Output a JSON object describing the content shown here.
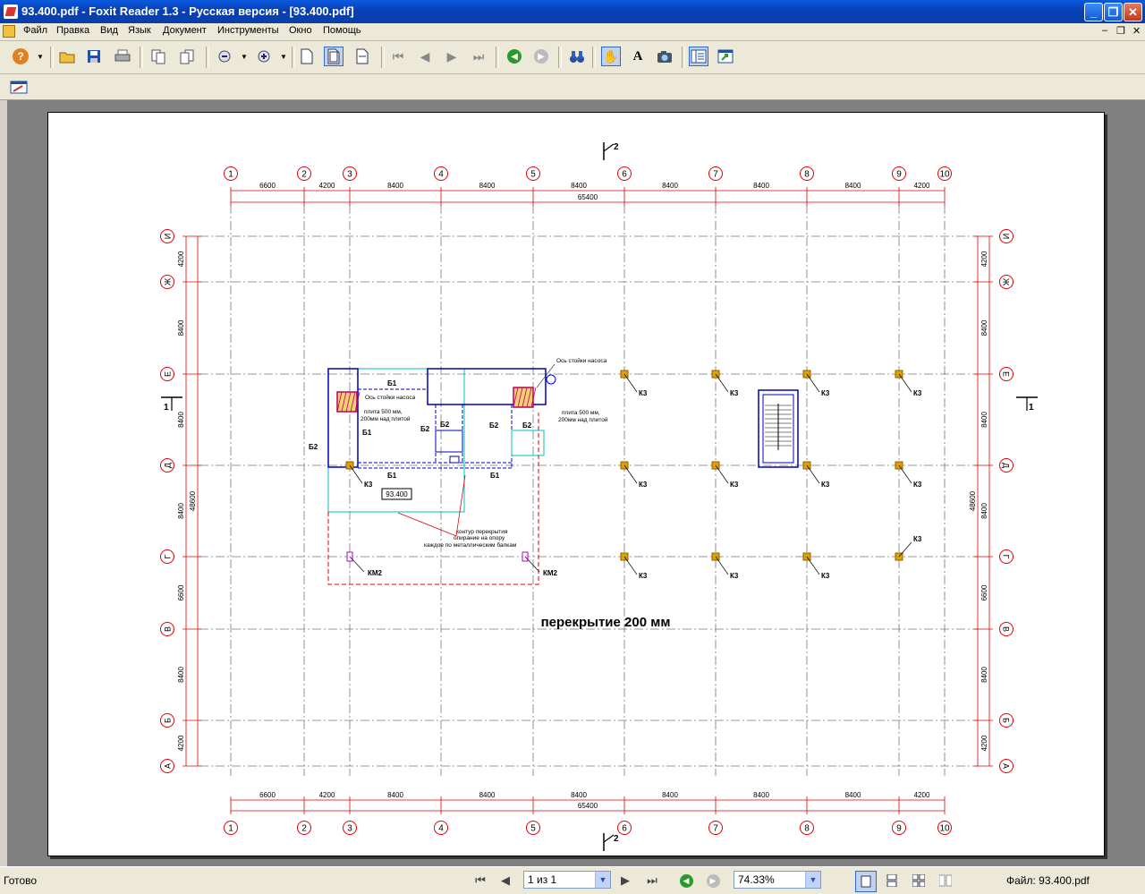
{
  "window": {
    "title": "93.400.pdf - Foxit Reader 1.3 - Русская версия  - [93.400.pdf]"
  },
  "menu": {
    "items": [
      "Файл",
      "Правка",
      "Вид",
      "Язык",
      "Документ",
      "Инструменты",
      "Окно",
      "Помощь"
    ]
  },
  "drawing": {
    "grid_columns": [
      "1",
      "2",
      "3",
      "4",
      "5",
      "6",
      "7",
      "8",
      "9",
      "10"
    ],
    "grid_rows": [
      "И",
      "Ж",
      "Е",
      "Д",
      "Г",
      "В",
      "Б",
      "А"
    ],
    "column_spacing": [
      "6600",
      "4200",
      "8400",
      "8400",
      "8400",
      "8400",
      "8400",
      "8400",
      "4200"
    ],
    "column_total": "65400",
    "row_spacing": [
      "4200",
      "8400",
      "8400",
      "8400",
      "6600",
      "8400",
      "4200"
    ],
    "row_total": "48600",
    "section_1": "1",
    "section_2": "2",
    "slab_label": "перекрытие 200 мм",
    "sheet_tag": "93.400",
    "beam_b1": "Б1",
    "beam_b2": "Б2",
    "column_k3": "К3",
    "column_km2": "КМ2",
    "note_col_axis": "Ось стойки насоса",
    "note_plinth": "плита 500 мм,",
    "note_plinth_2": "200мм над плитой",
    "note_contour_1": "контур перекрытия",
    "note_contour_2": "опирание на опору",
    "note_contour_3": "каждое по металлическим балкам",
    "colors": {
      "grid": "#e00000",
      "beam": "#0000c0",
      "slab": "#00c0c0",
      "k3": "#e0a000",
      "km2": "#c000c0",
      "hatch": "#c00060"
    }
  },
  "status": {
    "ready": "Готово",
    "page_indicator": "1 из 1",
    "zoom": "74.33%",
    "file": "Файл: 93.400.pdf"
  }
}
